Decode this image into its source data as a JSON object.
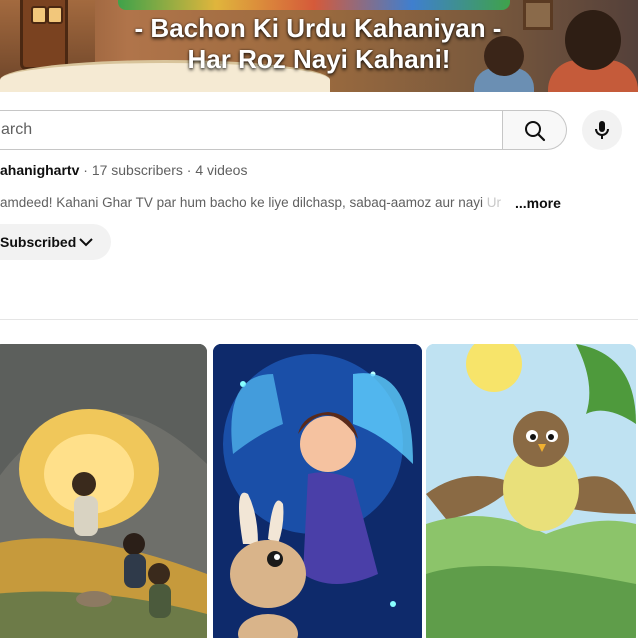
{
  "banner": {
    "line1": "- Bachon Ki Urdu Kahaniyan -",
    "line2": "Har Roz Nayi Kahani!"
  },
  "search": {
    "placeholder": "arch",
    "button_icon": "search-icon",
    "mic_icon": "microphone-icon"
  },
  "channel": {
    "handle": "ahanighartv",
    "separator": " · ",
    "subscribers": "17 subscribers",
    "videos": "4 videos",
    "description": "amdeed! Kahani Ghar TV par hum bacho ke liye dilchasp, sabaq-aamoz aur nayi ",
    "description_fade": "Ur",
    "more_label": "...more",
    "subscribe_label": "Subscribed",
    "subscribe_icon": "chevron-down-icon"
  },
  "videos": [
    {
      "thumbnail": "cave-treasure-thumbnail"
    },
    {
      "thumbnail": "fairy-bunny-thumbnail"
    },
    {
      "thumbnail": "flying-bird-thumbnail"
    }
  ],
  "colors": {
    "text_primary": "#0f0f0f",
    "text_secondary": "#606060",
    "chip_bg": "#f2f2f2",
    "border": "#c6c6c6"
  }
}
